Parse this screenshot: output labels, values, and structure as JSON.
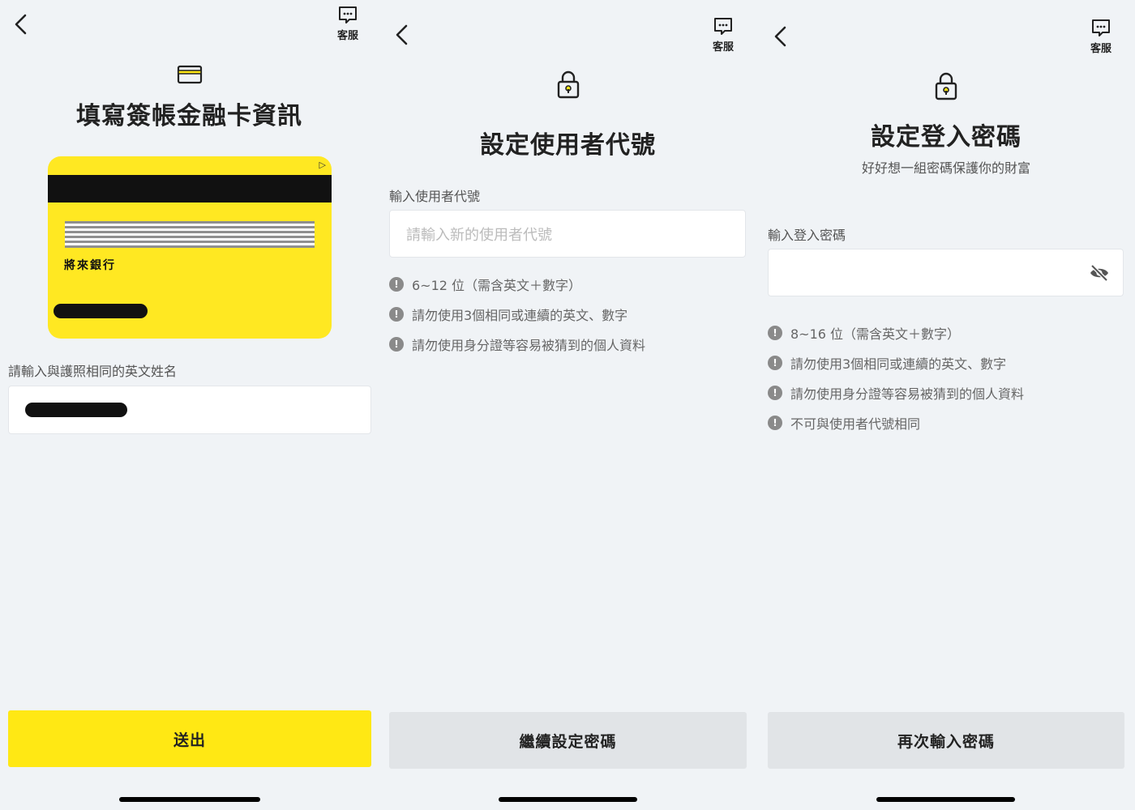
{
  "common": {
    "cs_label": "客服",
    "hint_mark": "!"
  },
  "card_form": {
    "title": "填寫簽帳金融卡資訊",
    "card_bank_name": "將來銀行",
    "card_play_glyph": "▷",
    "name_label": "請輸入與護照相同的英文姓名",
    "submit_label": "送出"
  },
  "user_id_form": {
    "title": "設定使用者代號",
    "field_label": "輸入使用者代號",
    "placeholder": "請輸入新的使用者代號",
    "hints": [
      "6~12 位（需含英文＋數字）",
      "請勿使用3個相同或連續的英文、數字",
      "請勿使用身分證等容易被猜到的個人資料"
    ],
    "continue_label": "繼續設定密碼"
  },
  "password_form": {
    "title": "設定登入密碼",
    "subtitle": "好好想一組密碼保護你的財富",
    "field_label": "輸入登入密碼",
    "hints": [
      "8~16 位（需含英文＋數字）",
      "請勿使用3個相同或連續的英文、數字",
      "請勿使用身分證等容易被猜到的個人資料",
      "不可與使用者代號相同"
    ],
    "reenter_label": "再次輸入密碼"
  },
  "colors": {
    "accent_yellow": "#ffe814",
    "background": "#f0f3f6",
    "disabled_button": "#e1e4e7"
  },
  "icons": [
    "back-arrow-icon",
    "chat-bubble-icon",
    "credit-card-icon",
    "lock-icon",
    "eye-slash-icon",
    "exclamation-icon"
  ]
}
